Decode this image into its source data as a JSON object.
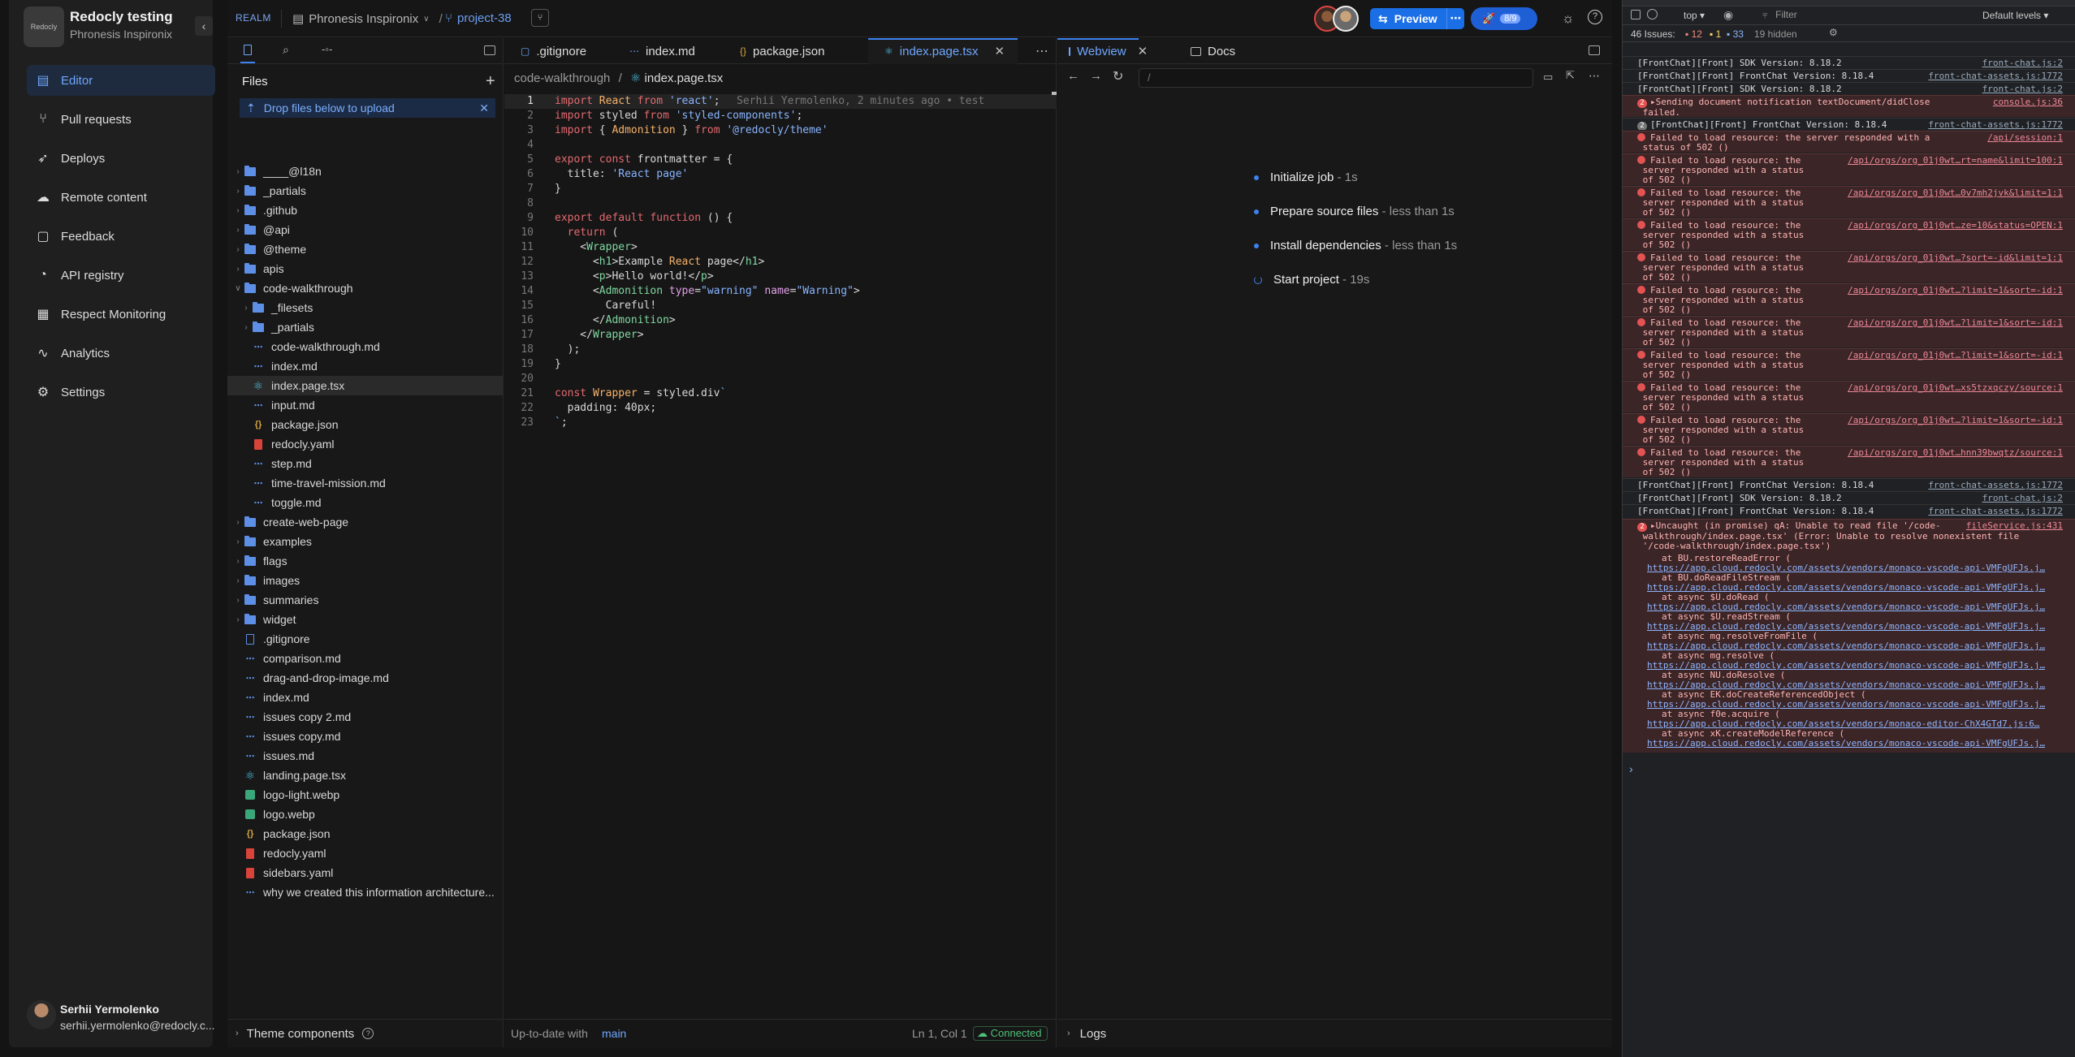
{
  "sidebar": {
    "org_logo": "Redocly",
    "org_name": "Redocly testing",
    "org_sub": "Phronesis Inspironix",
    "items": [
      {
        "label": "Editor",
        "icon": "editor-icon"
      },
      {
        "label": "Pull requests",
        "icon": "pull-request-icon"
      },
      {
        "label": "Deploys",
        "icon": "rocket-icon"
      },
      {
        "label": "Remote content",
        "icon": "cloud-icon"
      },
      {
        "label": "Feedback",
        "icon": "chat-icon"
      },
      {
        "label": "API registry",
        "icon": "api-icon"
      },
      {
        "label": "Respect Monitoring",
        "icon": "monitor-icon"
      },
      {
        "label": "Analytics",
        "icon": "chart-icon"
      },
      {
        "label": "Settings",
        "icon": "gear-icon"
      }
    ],
    "user_name": "Serhii Yermolenko",
    "user_email": "serhii.yermolenko@redocly.c..."
  },
  "topbar": {
    "realm": "REALM",
    "project": "Phronesis Inspironix",
    "slash": "/",
    "branch": "project-38",
    "preview_label": "Preview",
    "deploy_count": "8/9"
  },
  "files": {
    "title": "Files",
    "drop_banner": "Drop files below to upload",
    "tree": [
      {
        "name": "____@l18n",
        "type": "folder",
        "depth": 0
      },
      {
        "name": "_partials",
        "type": "folder",
        "depth": 0
      },
      {
        "name": ".github",
        "type": "folder",
        "depth": 0
      },
      {
        "name": "@api",
        "type": "folder",
        "depth": 0
      },
      {
        "name": "@theme",
        "type": "folder",
        "depth": 0
      },
      {
        "name": "apis",
        "type": "folder",
        "depth": 0
      },
      {
        "name": "code-walkthrough",
        "type": "folder-open",
        "depth": 0
      },
      {
        "name": "_filesets",
        "type": "folder",
        "depth": 1
      },
      {
        "name": "_partials",
        "type": "folder",
        "depth": 1
      },
      {
        "name": "code-walkthrough.md",
        "type": "md",
        "depth": 1
      },
      {
        "name": "index.md",
        "type": "md",
        "depth": 1
      },
      {
        "name": "index.page.tsx",
        "type": "react",
        "depth": 1,
        "selected": true
      },
      {
        "name": "input.md",
        "type": "md",
        "depth": 1
      },
      {
        "name": "package.json",
        "type": "json",
        "depth": 1
      },
      {
        "name": "redocly.yaml",
        "type": "yaml",
        "depth": 1
      },
      {
        "name": "step.md",
        "type": "md",
        "depth": 1
      },
      {
        "name": "time-travel-mission.md",
        "type": "md",
        "depth": 1
      },
      {
        "name": "toggle.md",
        "type": "md",
        "depth": 1
      },
      {
        "name": "create-web-page",
        "type": "folder",
        "depth": 0
      },
      {
        "name": "examples",
        "type": "folder",
        "depth": 0
      },
      {
        "name": "flags",
        "type": "folder",
        "depth": 0
      },
      {
        "name": "images",
        "type": "folder",
        "depth": 0
      },
      {
        "name": "summaries",
        "type": "folder",
        "depth": 0
      },
      {
        "name": "widget",
        "type": "folder",
        "depth": 0
      },
      {
        "name": ".gitignore",
        "type": "plain",
        "depth": 0
      },
      {
        "name": "comparison.md",
        "type": "md",
        "depth": 0
      },
      {
        "name": "drag-and-drop-image.md",
        "type": "md",
        "depth": 0
      },
      {
        "name": "index.md",
        "type": "md",
        "depth": 0
      },
      {
        "name": "issues copy 2.md",
        "type": "md",
        "depth": 0
      },
      {
        "name": "issues copy.md",
        "type": "md",
        "depth": 0
      },
      {
        "name": "issues.md",
        "type": "md",
        "depth": 0
      },
      {
        "name": "landing.page.tsx",
        "type": "react",
        "depth": 0
      },
      {
        "name": "logo-light.webp",
        "type": "img",
        "depth": 0
      },
      {
        "name": "logo.webp",
        "type": "img",
        "depth": 0
      },
      {
        "name": "package.json",
        "type": "json",
        "depth": 0
      },
      {
        "name": "redocly.yaml",
        "type": "yaml",
        "depth": 0
      },
      {
        "name": "sidebars.yaml",
        "type": "yaml",
        "depth": 0
      },
      {
        "name": "why we created this information architecture...",
        "type": "md",
        "depth": 0
      }
    ],
    "bottom_label": "Theme components"
  },
  "editor": {
    "tabs": [
      {
        "label": ".gitignore",
        "icon": "file-icon"
      },
      {
        "label": "index.md",
        "icon": "markdown-icon"
      },
      {
        "label": "package.json",
        "icon": "json-icon"
      },
      {
        "label": "index.page.tsx",
        "icon": "react-icon",
        "active": true
      }
    ],
    "crumb_folder": "code-walkthrough",
    "crumb_sep": "/",
    "crumb_file": "index.page.tsx",
    "blame": "Serhii Yermolenko, 2 minutes ago • test",
    "lines": [
      "import React from 'react';",
      "import styled from 'styled-components';",
      "import { Admonition } from '@redocly/theme'",
      "",
      "export const frontmatter = {",
      "  title: 'React page'",
      "}",
      "",
      "export default function () {",
      "  return (",
      "    <Wrapper>",
      "      <h1>Example React page</h1>",
      "      <p>Hello world!</p>",
      "      <Admonition type=\"warning\" name=\"Warning\">",
      "        Careful!",
      "      </Admonition>",
      "    </Wrapper>",
      "  );",
      "}",
      "",
      "const Wrapper = styled.div`",
      "  padding: 40px;",
      "`;"
    ],
    "status_left": "Up-to-date with",
    "status_branch": "main",
    "status_pos": "Ln 1, Col 1",
    "status_conn": "Connected"
  },
  "webview": {
    "tab_webview": "Webview",
    "tab_docs": "Docs",
    "url": "/",
    "steps": [
      {
        "label": "Initialize job",
        "time": "1s"
      },
      {
        "label": "Prepare source files",
        "time": "less than 1s"
      },
      {
        "label": "Install dependencies",
        "time": "less than 1s"
      },
      {
        "label": "Start project",
        "time": "19s"
      }
    ],
    "logs_label": "Logs"
  },
  "devtools": {
    "context": "top",
    "filter_placeholder": "Filter",
    "levels": "Default levels",
    "issues_label": "46 Issues:",
    "issues_err": "12",
    "issues_warn": "1",
    "issues_info": "33",
    "hidden": "19 hidden",
    "prompt": "›"
  },
  "console": [
    {
      "kind": "info",
      "text": "[FrontChat][Front] SDK Version: 8.18.2",
      "src": "front-chat.js:2"
    },
    {
      "kind": "info",
      "text": "[FrontChat][Front] FrontChat Version: 8.18.4",
      "src": "front-chat-assets.js:1772"
    },
    {
      "kind": "info",
      "text": "[FrontChat][Front] SDK Version: 8.18.2",
      "src": "front-chat.js:2"
    },
    {
      "kind": "err",
      "count": "2",
      "text": "▸Sending document notification textDocument/didClose\n failed.",
      "src": "console.js:36"
    },
    {
      "kind": "info",
      "count": "2",
      "text": "[FrontChat][Front] FrontChat Version: 8.18.4",
      "src": "front-chat-assets.js:1772"
    },
    {
      "kind": "err",
      "text": "Failed to load resource: the server responded with a\n status of 502 ()",
      "src": "/api/session:1"
    },
    {
      "kind": "err",
      "text": "Failed to load resource: the\n server responded with a status\n of 502 ()",
      "src": "/api/orgs/org_01j0wt…rt=name&limit=100:1"
    },
    {
      "kind": "err",
      "text": "Failed to load resource: the\n server responded with a status\n of 502 ()",
      "src": "/api/orgs/org_01j0wt…0v7mh2jvk&limit=1:1"
    },
    {
      "kind": "err",
      "text": "Failed to load resource: the\n server responded with a status\n of 502 ()",
      "src": "/api/orgs/org_01j0wt…ze=10&status=OPEN:1"
    },
    {
      "kind": "err",
      "text": "Failed to load resource: the\n server responded with a status\n of 502 ()",
      "src": "/api/orgs/org_01j0wt…?sort=-id&limit=1:1"
    },
    {
      "kind": "err",
      "text": "Failed to load resource: the\n server responded with a status\n of 502 ()",
      "src": "/api/orgs/org_01j0wt…?limit=1&sort=-id:1"
    },
    {
      "kind": "err",
      "text": "Failed to load resource: the\n server responded with a status\n of 502 ()",
      "src": "/api/orgs/org_01j0wt…?limit=1&sort=-id:1"
    },
    {
      "kind": "err",
      "text": "Failed to load resource: the\n server responded with a status\n of 502 ()",
      "src": "/api/orgs/org_01j0wt…?limit=1&sort=-id:1"
    },
    {
      "kind": "err",
      "text": "Failed to load resource: the\n server responded with a status\n of 502 ()",
      "src": "/api/orgs/org_01j0wt…xs5tzxqczy/source:1"
    },
    {
      "kind": "err",
      "text": "Failed to load resource: the\n server responded with a status\n of 502 ()",
      "src": "/api/orgs/org_01j0wt…?limit=1&sort=-id:1"
    },
    {
      "kind": "err",
      "text": "Failed to load resource: the\n server responded with a status\n of 502 ()",
      "src": "/api/orgs/org_01j0wt…hnn39bwqtz/source:1"
    },
    {
      "kind": "info",
      "text": "[FrontChat][Front] FrontChat Version: 8.18.4",
      "src": "front-chat-assets.js:1772"
    },
    {
      "kind": "info",
      "text": "[FrontChat][Front] SDK Version: 8.18.2",
      "src": "front-chat.js:2"
    },
    {
      "kind": "info",
      "text": "[FrontChat][Front] FrontChat Version: 8.18.4",
      "src": "front-chat-assets.js:1772"
    }
  ],
  "uncaught": {
    "count": "2",
    "head": "▸Uncaught (in promise) qA: Unable to read file '/code-\n walkthrough/index.page.tsx' (Error: Unable to resolve nonexistent file\n '/code-walkthrough/index.page.tsx')",
    "src": "fileService.js:431",
    "frames": [
      {
        "at": "at BU.restoreReadError (",
        "url": "https://app.cloud.redocly.com/assets/vendors/monaco-vscode-api-VMFgUFJs.j…"
      },
      {
        "at": "at BU.doReadFileStream (",
        "url": "https://app.cloud.redocly.com/assets/vendors/monaco-vscode-api-VMFgUFJs.j…"
      },
      {
        "at": "at async $U.doRead (",
        "url": "https://app.cloud.redocly.com/assets/vendors/monaco-vscode-api-VMFgUFJs.j…"
      },
      {
        "at": "at async $U.readStream (",
        "url": "https://app.cloud.redocly.com/assets/vendors/monaco-vscode-api-VMFgUFJs.j…"
      },
      {
        "at": "at async mg.resolveFromFile (",
        "url": "https://app.cloud.redocly.com/assets/vendors/monaco-vscode-api-VMFgUFJs.j…"
      },
      {
        "at": "at async mg.resolve (",
        "url": "https://app.cloud.redocly.com/assets/vendors/monaco-vscode-api-VMFgUFJs.j…"
      },
      {
        "at": "at async NU.doResolve (",
        "url": "https://app.cloud.redocly.com/assets/vendors/monaco-vscode-api-VMFgUFJs.j…"
      },
      {
        "at": "at async EK.doCreateReferencedObject (",
        "url": "https://app.cloud.redocly.com/assets/vendors/monaco-vscode-api-VMFgUFJs.j…"
      },
      {
        "at": "at async f0e.acquire (",
        "url": "https://app.cloud.redocly.com/assets/vendors/monaco-editor-ChX4GTd7.js:6…"
      },
      {
        "at": "at async xK.createModelReference (",
        "url": "https://app.cloud.redocly.com/assets/vendors/monaco-vscode-api-VMFgUFJs.j…"
      }
    ]
  }
}
